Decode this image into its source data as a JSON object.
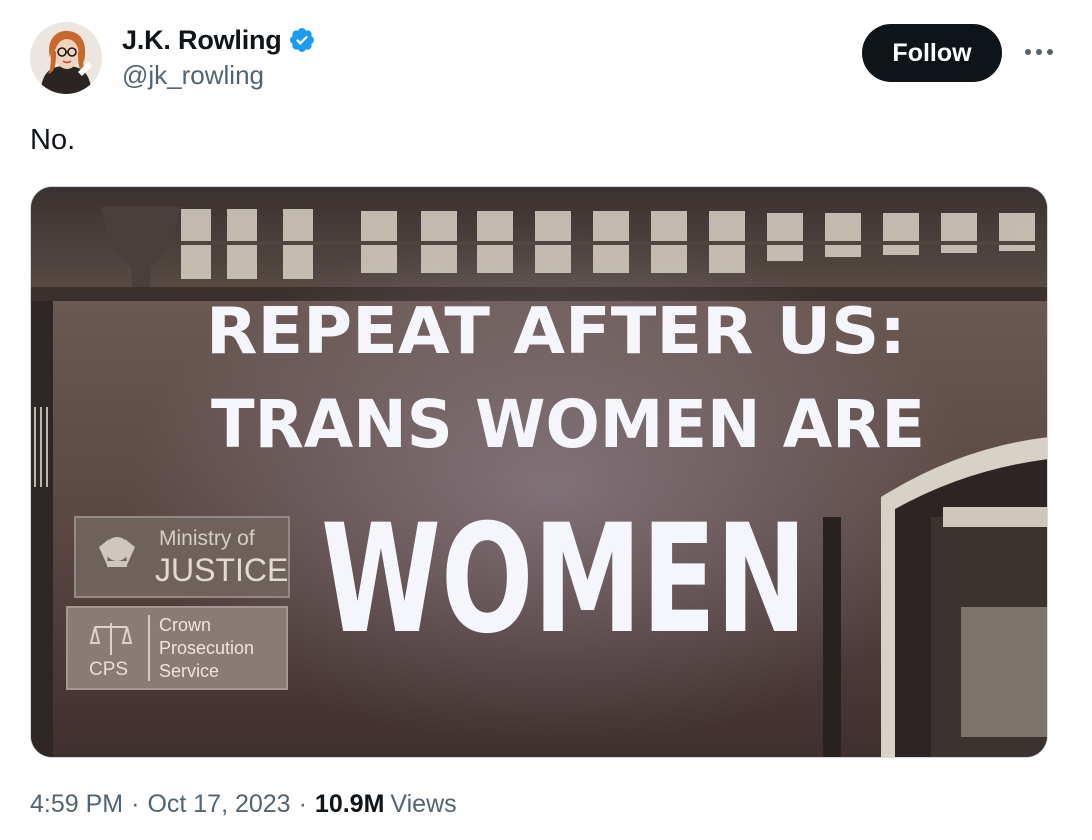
{
  "author": {
    "display_name": "J.K. Rowling",
    "handle": "@jk_rowling",
    "verified": true,
    "verified_color": "#1d9bf0"
  },
  "actions": {
    "follow_label": "Follow",
    "more_icon": "more-horizontal-icon"
  },
  "tweet": {
    "text": "No."
  },
  "media": {
    "projection_lines": [
      "REPEAT AFTER US:",
      "TRANS WOMEN ARE",
      "WOMEN"
    ],
    "sign_moj": [
      "Ministry of",
      "JUSTICE"
    ],
    "sign_cps": [
      "Crown",
      "Prosecution",
      "Service"
    ],
    "sign_cps_abbr": "CPS"
  },
  "meta": {
    "time": "4:59 PM",
    "separator": "·",
    "date": "Oct 17, 2023",
    "views_count": "10.9M",
    "views_label": "Views"
  },
  "colors": {
    "text_primary": "#0f1419",
    "text_secondary": "#536471",
    "follow_bg": "#0f1419",
    "projection": "#f4f6fb",
    "wall": "#5a4744"
  }
}
